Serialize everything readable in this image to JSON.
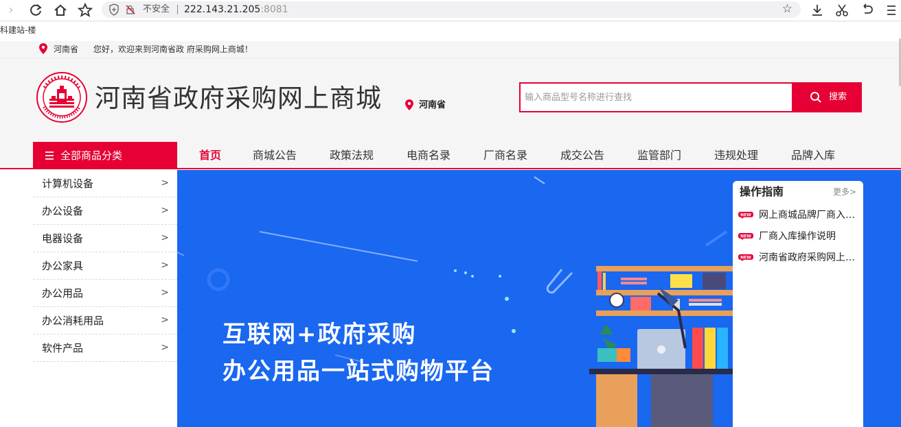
{
  "browser": {
    "security_label": "不安全",
    "url_host": "222.143.21.205",
    "url_port": ":8081",
    "bookmark": "科建站-楼"
  },
  "topbar": {
    "province": "河南省",
    "welcome": "您好，欢迎来到河南省政 府采购网上商城！"
  },
  "header": {
    "site_title": "河南省政府采购网上商城",
    "province": "河南省",
    "search_placeholder": "输入商品型号名称进行查找",
    "search_button": "搜索"
  },
  "nav": {
    "all_categories": "全部商品分类",
    "items": [
      "首页",
      "商城公告",
      "政策法规",
      "电商名录",
      "厂商名录",
      "成交公告",
      "监管部门",
      "违规处理",
      "品牌入库"
    ]
  },
  "sidebar": {
    "items": [
      {
        "label": "计算机设备",
        "arrow": ">"
      },
      {
        "label": "办公设备",
        "arrow": ">"
      },
      {
        "label": "电器设备",
        "arrow": ">"
      },
      {
        "label": "办公家具",
        "arrow": ">"
      },
      {
        "label": "办公用品",
        "arrow": ">"
      },
      {
        "label": "办公消耗用品",
        "arrow": ">"
      },
      {
        "label": "软件产品",
        "arrow": ">"
      }
    ]
  },
  "banner": {
    "line1": "互联网+政府采购",
    "line2": "办公用品一站式购物平台"
  },
  "guide": {
    "title": "操作指南",
    "more": "更多>",
    "items": [
      {
        "tag": "NEW",
        "text": "网上商城品牌厂商入库说明"
      },
      {
        "tag": "NEW",
        "text": "厂商入库操作说明"
      },
      {
        "tag": "NEW",
        "text": "河南省政府采购网上商城"
      }
    ]
  },
  "colors": {
    "accent": "#e60033",
    "banner_bg": "#1a67f0"
  }
}
